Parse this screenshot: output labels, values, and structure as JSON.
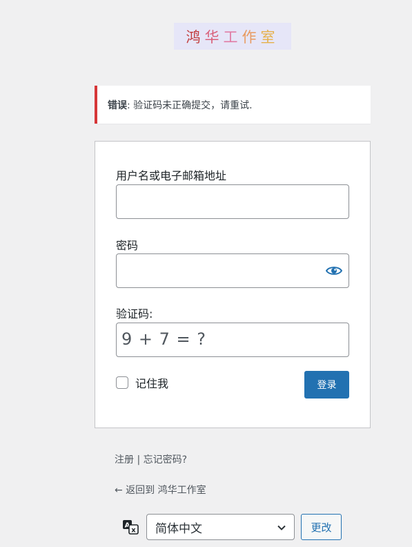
{
  "logo": {
    "chars": [
      "鸿",
      "华",
      "工",
      "作",
      "室"
    ]
  },
  "error": {
    "label": "错误",
    "message": ": 验证码未正确提交，请重试."
  },
  "form": {
    "username_label": "用户名或电子邮箱地址",
    "username_value": "",
    "password_label": "密码",
    "password_value": "",
    "captcha_label": "验证码:",
    "captcha_question": "9 + 7 = ?",
    "remember_label": "记住我",
    "remember_checked": false,
    "submit_label": "登录"
  },
  "nav": {
    "register": "注册",
    "separator": " | ",
    "lost_password": "忘记密码?",
    "back": "← 返回到 鸿华工作室"
  },
  "language": {
    "selected": "简体中文",
    "change_label": "更改"
  },
  "colors": {
    "background": "#f0f0f1",
    "primary": "#2271b1",
    "error_border": "#d63638"
  }
}
